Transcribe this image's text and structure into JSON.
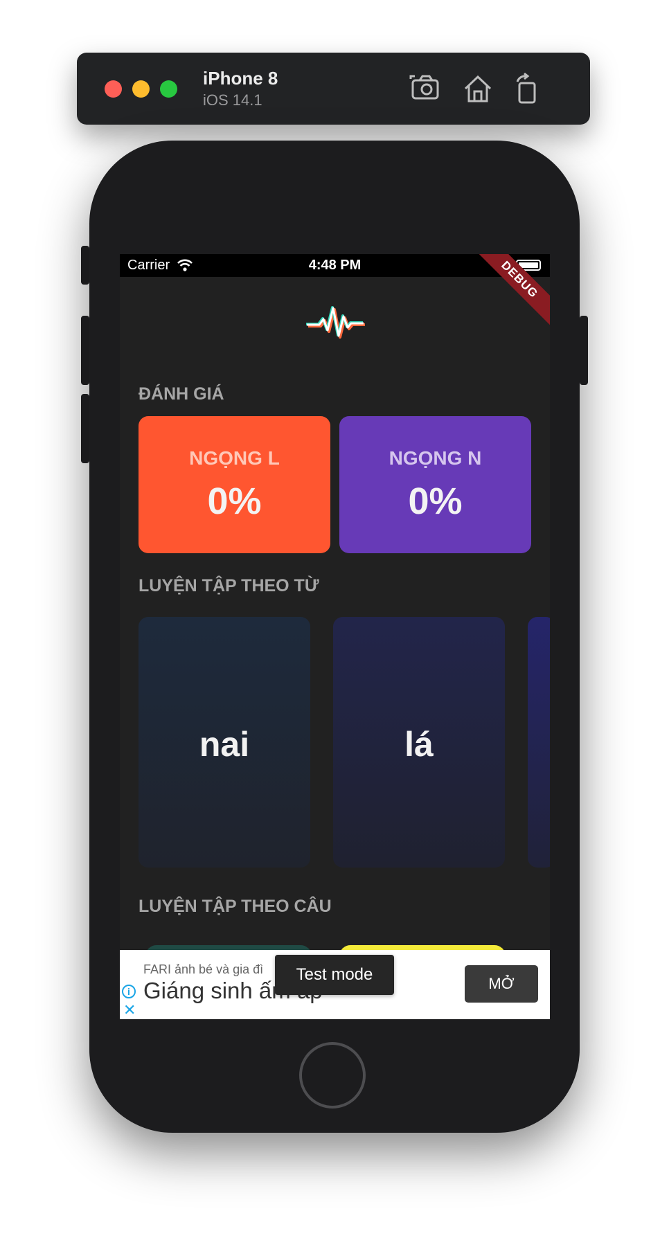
{
  "simulator": {
    "device_name": "iPhone 8",
    "os_version": "iOS 14.1"
  },
  "status_bar": {
    "carrier": "Carrier",
    "time": "4:48 PM",
    "debug_banner": "DEBUG"
  },
  "sections": {
    "evaluation": "ĐÁNH GIÁ",
    "word_practice": "LUYỆN TẬP THEO TỪ",
    "sentence_practice": "LUYỆN TẬP THEO CÂU"
  },
  "evaluation_cards": [
    {
      "name": "NGỌNG L",
      "percent": "0%",
      "color": "#ff5630"
    },
    {
      "name": "NGỌNG N",
      "percent": "0%",
      "color": "#673ab7"
    }
  ],
  "word_cards": [
    {
      "word": "nai"
    },
    {
      "word": "lá"
    }
  ],
  "ad": {
    "small_text": "FARI ảnh bé và gia đì",
    "big_text": "Giáng sinh ấm áp",
    "open_label": "MỞ",
    "test_mode_label": "Test mode"
  },
  "colors": {
    "screen_bg": "#212121",
    "evaluation_l": "#ff5630",
    "evaluation_n": "#673ab7",
    "sentence_card_1": "#1f4a44",
    "sentence_card_2": "#f4ea3a"
  }
}
